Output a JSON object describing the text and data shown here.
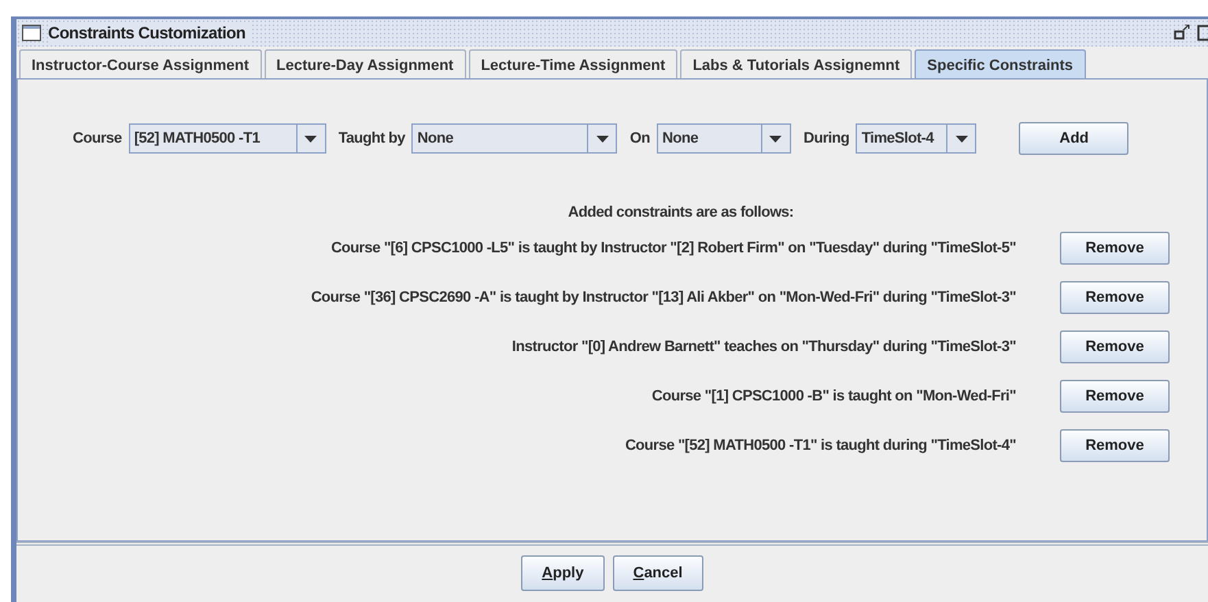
{
  "window": {
    "title": "Constraints Customization"
  },
  "tabs": [
    {
      "label": "Instructor-Course Assignment",
      "selected": false
    },
    {
      "label": "Lecture-Day Assignment",
      "selected": false
    },
    {
      "label": "Lecture-Time Assignment",
      "selected": false
    },
    {
      "label": "Labs & Tutorials Assignemnt",
      "selected": false
    },
    {
      "label": "Specific Constraints",
      "selected": true
    }
  ],
  "filters": [
    {
      "label": "Course",
      "value": "[52] MATH0500 -T1"
    },
    {
      "label": "Taught by",
      "value": "None"
    },
    {
      "label": "On",
      "value": "None"
    },
    {
      "label": "During",
      "value": "TimeSlot-4"
    }
  ],
  "add_button": "Add",
  "constraints_heading": "Added constraints are as follows:",
  "constraints": [
    {
      "text": "Course \"[6] CPSC1000 -L5\" is taught by Instructor \"[2] Robert Firm\" on \"Tuesday\" during \"TimeSlot-5\"",
      "button": "Remove"
    },
    {
      "text": "Course \"[36] CPSC2690 -A\" is taught by Instructor \"[13] Ali Akber\" on \"Mon-Wed-Fri\" during \"TimeSlot-3\"",
      "button": "Remove"
    },
    {
      "text": "Instructor \"[0] Andrew Barnett\" teaches on \"Thursday\" during \"TimeSlot-3\"",
      "button": "Remove"
    },
    {
      "text": "Course \"[1] CPSC1000 -B\" is taught on \"Mon-Wed-Fri\"",
      "button": "Remove"
    },
    {
      "text": "Course \"[52] MATH0500 -T1\" is taught during \"TimeSlot-4\"",
      "button": "Remove"
    }
  ],
  "buttons": [
    "Apply",
    "Cancel"
  ]
}
